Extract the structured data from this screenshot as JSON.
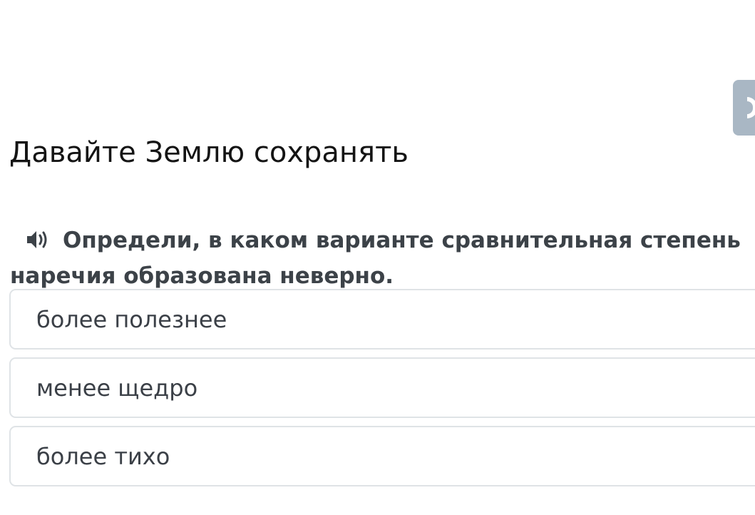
{
  "lesson": {
    "title": "Давайте Землю сохранять"
  },
  "question": {
    "line1": "Определи, в каком варианте сравнительная степень",
    "line2": "наречия образована неверно.",
    "audio_icon": "speaker-icon"
  },
  "options": [
    {
      "label": "более полезнее"
    },
    {
      "label": "менее щедро"
    },
    {
      "label": "более тихо"
    }
  ],
  "side_tab": {
    "icon": "exit-icon",
    "color": "#a9b7c4"
  },
  "colors": {
    "question_text": "#3c4248",
    "option_border": "#dfe3e6"
  }
}
